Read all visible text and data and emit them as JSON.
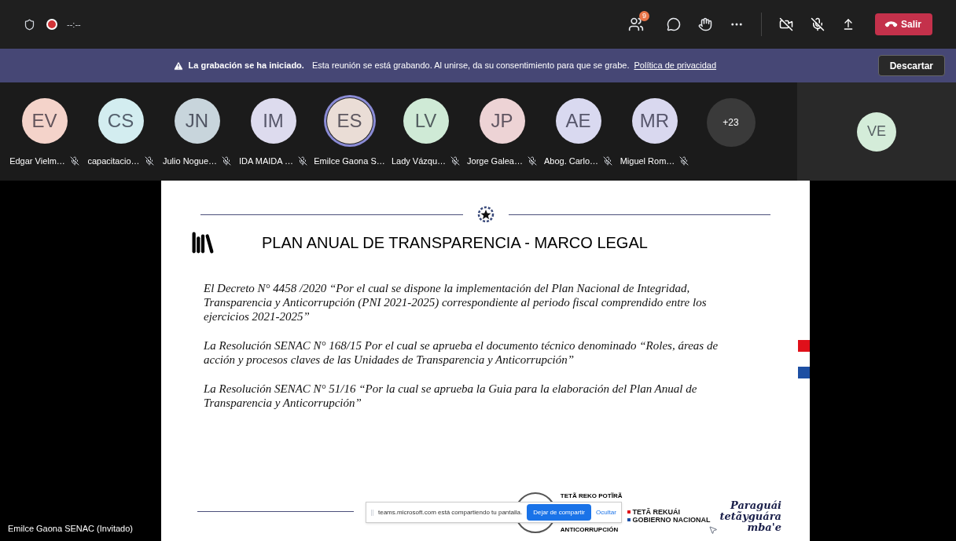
{
  "top_bar": {
    "timer": "--:--",
    "recording": true,
    "people_badge": "9",
    "leave_button": "Salir"
  },
  "banner": {
    "title": "La grabación se ha iniciado.",
    "message": "Esta reunión se está grabando. Al unirse, da su consentimiento para que se grabe.",
    "link": "Política de privacidad",
    "dismiss": "Descartar"
  },
  "participants": [
    {
      "initials": "EV",
      "name": "Edgar Vielm…",
      "muted": true,
      "speaking": false,
      "color": "#f4d3ca"
    },
    {
      "initials": "CS",
      "name": "capacitacio…",
      "muted": true,
      "speaking": false,
      "color": "#d3edf0"
    },
    {
      "initials": "JN",
      "name": "Julio Nogue…",
      "muted": true,
      "speaking": false,
      "color": "#c8d5dc"
    },
    {
      "initials": "IM",
      "name": "IDA MAIDA …",
      "muted": true,
      "speaking": false,
      "color": "#dddbee"
    },
    {
      "initials": "ES",
      "name": "Emilce Gaona S…",
      "muted": false,
      "speaking": true,
      "color": "#eaddd6"
    },
    {
      "initials": "LV",
      "name": "Lady Vázqu…",
      "muted": true,
      "speaking": false,
      "color": "#cfead6"
    },
    {
      "initials": "JP",
      "name": "Jorge Galea…",
      "muted": true,
      "speaking": false,
      "color": "#edd3d5"
    },
    {
      "initials": "AE",
      "name": "Abog. Carlo…",
      "muted": true,
      "speaking": false,
      "color": "#d9d9f0"
    },
    {
      "initials": "MR",
      "name": "Miguel Rom…",
      "muted": true,
      "speaking": false,
      "color": "#d9d8ef"
    }
  ],
  "overflow_count": "+23",
  "self_view": {
    "initials": "VE",
    "color": "#d4ecd9"
  },
  "slide": {
    "title": "PLAN ANUAL DE TRANSPARENCIA - MARCO LEGAL",
    "paragraphs": [
      "El Decreto N°  4458  /2020 “Por el cual se dispone la implementación del Plan Nacional de Integridad, Transparencia y Anticorrupción (PNI 2021-2025) correspondiente al periodo fiscal comprendido entre los ejercicios 2021-2025”",
      "La Resolución SENAC N° 168/15 Por el cual se aprueba el documento técnico denominado “Roles, áreas de acción y procesos claves de las Unidades de Transparencia y Anticorrupción”",
      "La Resolución SENAC N° 51/16 “Por la cual se aprueba la Guia para la elaboración del Plan Anual de Transparencia y Anticorrupción”"
    ],
    "seal_caption_top": "TETÃ REKO POTĨRÃ",
    "seal_caption_bottom": "ANTICORRUPCIÓN",
    "government_logo": [
      "TETÃ REKUÁI",
      "GOBIERNO NACIONAL"
    ],
    "slogan": [
      "Paraguái",
      "tetãyguára",
      "mba'e"
    ]
  },
  "share_bar": {
    "message": "teams.microsoft.com está compartiendo tu pantalla.",
    "stop_button": "Dejar de compartir",
    "hide_link": "Ocultar"
  },
  "presenter_label": "Emilce Gaona SENAC (Invitado)"
}
